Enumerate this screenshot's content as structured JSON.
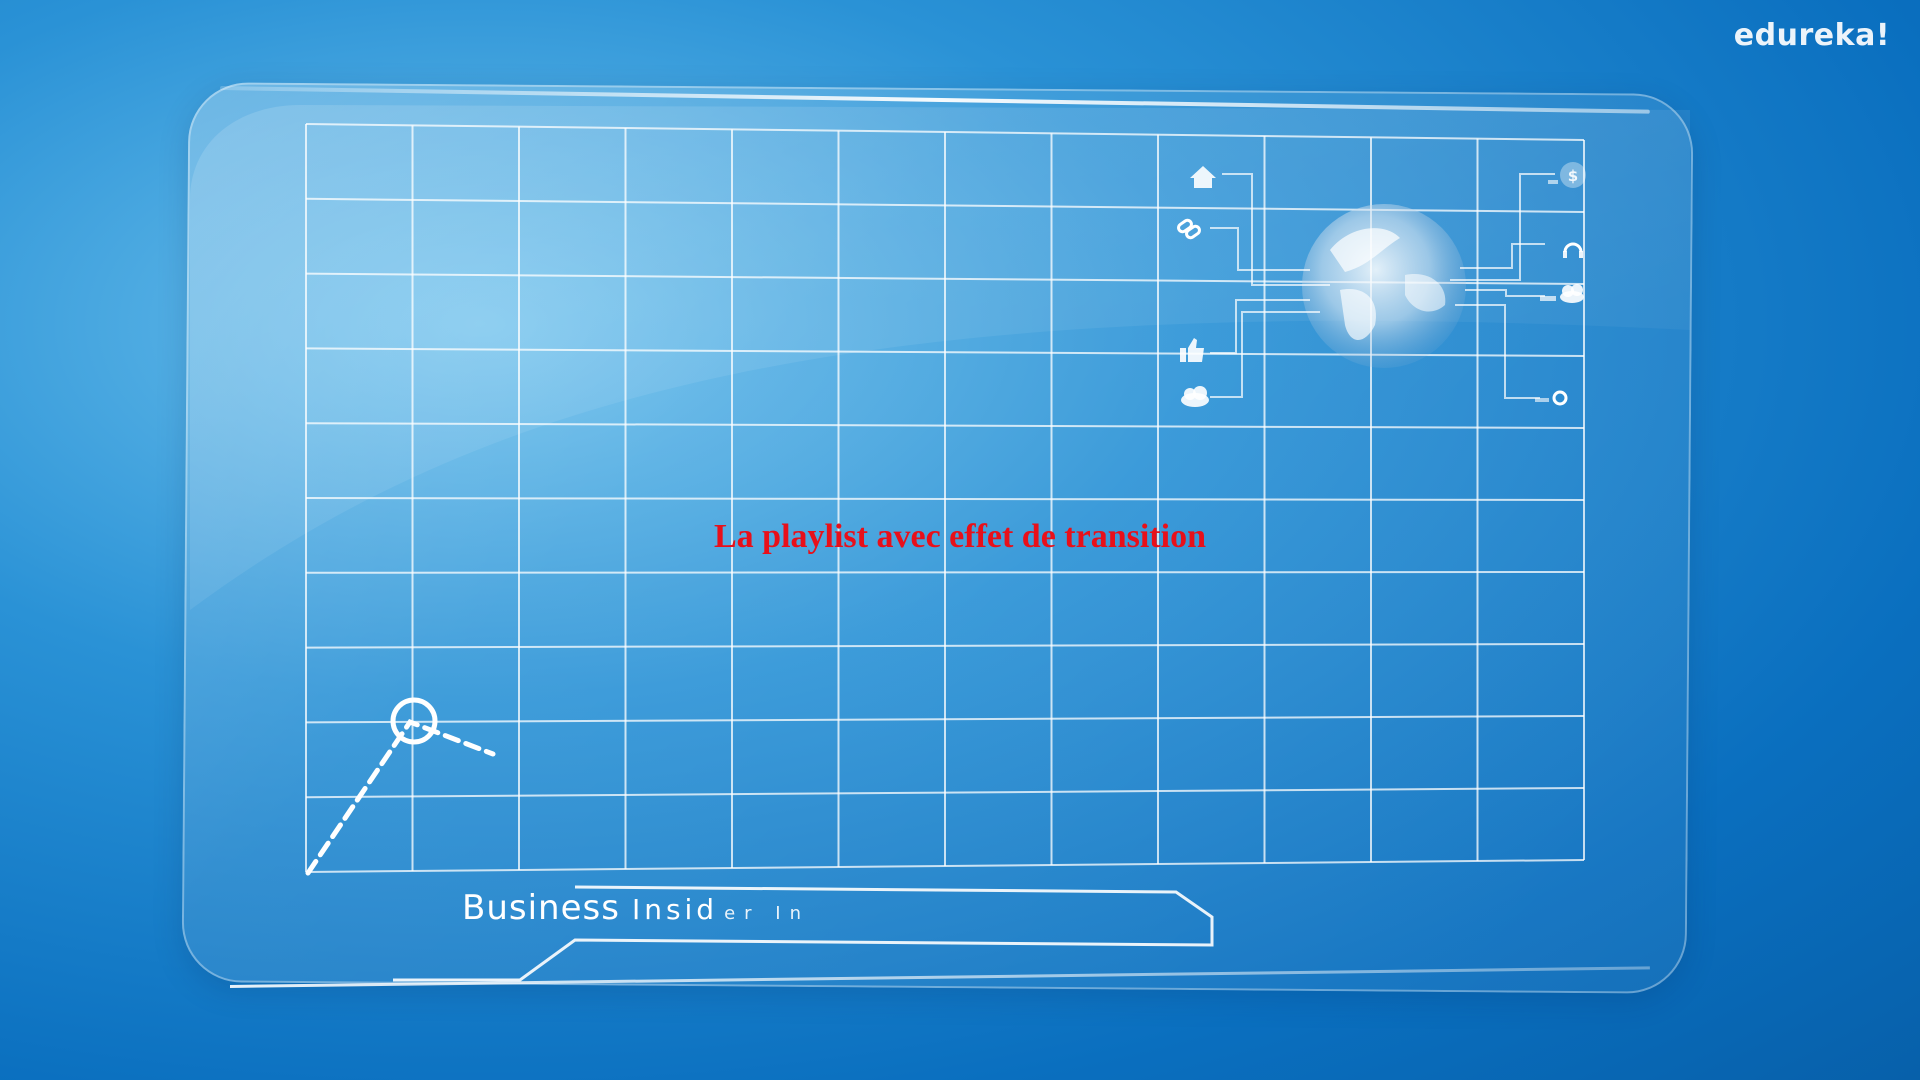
{
  "brand": {
    "logo_text": "edureka!"
  },
  "overlay": {
    "title": "La playlist avec effet de transition",
    "title_color": "#e8101a"
  },
  "lower_third": {
    "word1": "Business",
    "word2": "Insid",
    "word3": "er In"
  },
  "globe_icons": [
    "home-icon",
    "link-icon",
    "thumbs-up-icon",
    "cloud-icon",
    "dollar-icon",
    "headphones-icon",
    "cloud-upload-icon",
    "circle-icon"
  ],
  "colors": {
    "background": "#0a6fbf",
    "grid_line": "#ffffff"
  }
}
